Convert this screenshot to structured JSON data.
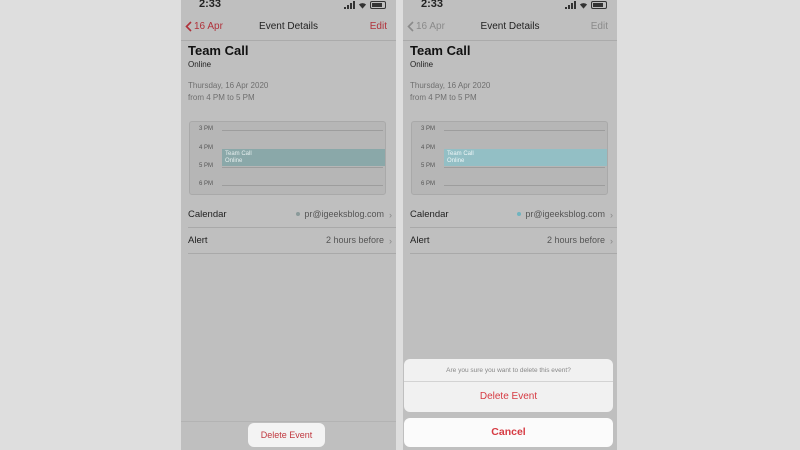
{
  "colors": {
    "accent_red": "#b0313a",
    "destructive": "#d63a42",
    "event_teal": "#93bfc5"
  },
  "left": {
    "status_time": "2:33",
    "nav": {
      "back_label": "16 Apr",
      "title": "Event Details",
      "edit_label": "Edit"
    },
    "event": {
      "title": "Team Call",
      "location": "Online",
      "date": "Thursday, 16 Apr 2020",
      "time_range": "from 4 PM to 5 PM"
    },
    "timeline": {
      "hours": [
        "3 PM",
        "4 PM",
        "5 PM",
        "6 PM"
      ],
      "event_title": "Team Call",
      "event_location": "Online"
    },
    "rows": [
      {
        "label": "Calendar",
        "value": "pr@igeeksblog.com"
      },
      {
        "label": "Alert",
        "value": "2 hours before"
      }
    ],
    "delete_button_label": "Delete Event"
  },
  "right": {
    "status_time": "2:33",
    "nav": {
      "back_label": "16 Apr",
      "title": "Event Details",
      "edit_label": "Edit"
    },
    "event": {
      "title": "Team Call",
      "location": "Online",
      "date": "Thursday, 16 Apr 2020",
      "time_range": "from 4 PM to 5 PM"
    },
    "timeline": {
      "hours": [
        "3 PM",
        "4 PM",
        "5 PM",
        "6 PM"
      ],
      "event_title": "Team Call",
      "event_location": "Online"
    },
    "rows": [
      {
        "label": "Calendar",
        "value": "pr@igeeksblog.com"
      },
      {
        "label": "Alert",
        "value": "2 hours before"
      }
    ],
    "action_sheet": {
      "question": "Are you sure you want to delete this event?",
      "delete_label": "Delete Event",
      "cancel_label": "Cancel"
    }
  }
}
